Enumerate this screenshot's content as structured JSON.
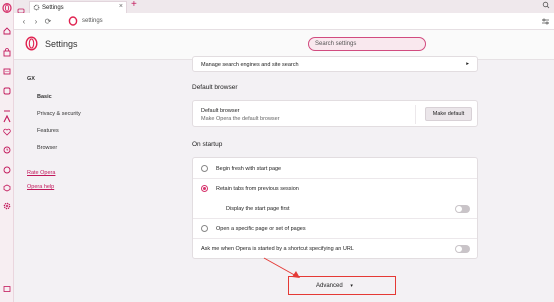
{
  "browser": {
    "tab_title": "Settings",
    "tab_close": "×",
    "new_tab": "+",
    "address": "settings",
    "back": "‹",
    "forward": "›",
    "reload": "⟳"
  },
  "header": {
    "title": "Settings",
    "search_placeholder": "Search settings"
  },
  "sidebar": {
    "gx": "GX",
    "items": [
      {
        "label": "Basic"
      },
      {
        "label": "Privacy & security"
      },
      {
        "label": "Features"
      },
      {
        "label": "Browser"
      }
    ],
    "links": [
      {
        "label": "Rate Opera"
      },
      {
        "label": "Opera help"
      }
    ]
  },
  "main": {
    "search_engines_row": "Manage search engines and site search",
    "search_engines_chevron": "▸",
    "default_browser": {
      "section_title": "Default browser",
      "label": "Default browser",
      "sub": "Make Opera the default browser",
      "button": "Make default"
    },
    "on_startup": {
      "section_title": "On startup",
      "options": [
        {
          "label": "Begin fresh with start page",
          "checked": false
        },
        {
          "label": "Retain tabs from previous session",
          "checked": true
        },
        {
          "label": "Open a specific page or set of pages",
          "checked": false
        }
      ],
      "display_start_page": "Display the start page first",
      "display_start_page_on": false,
      "ask_shortcut": "Ask me when Opera is started by a shortcut specifying an URL",
      "ask_shortcut_on": false
    },
    "advanced": {
      "label": "Advanced",
      "chevron": "▾"
    }
  },
  "colors": {
    "accent": "#d6336c",
    "highlight_box": "#e53935"
  }
}
